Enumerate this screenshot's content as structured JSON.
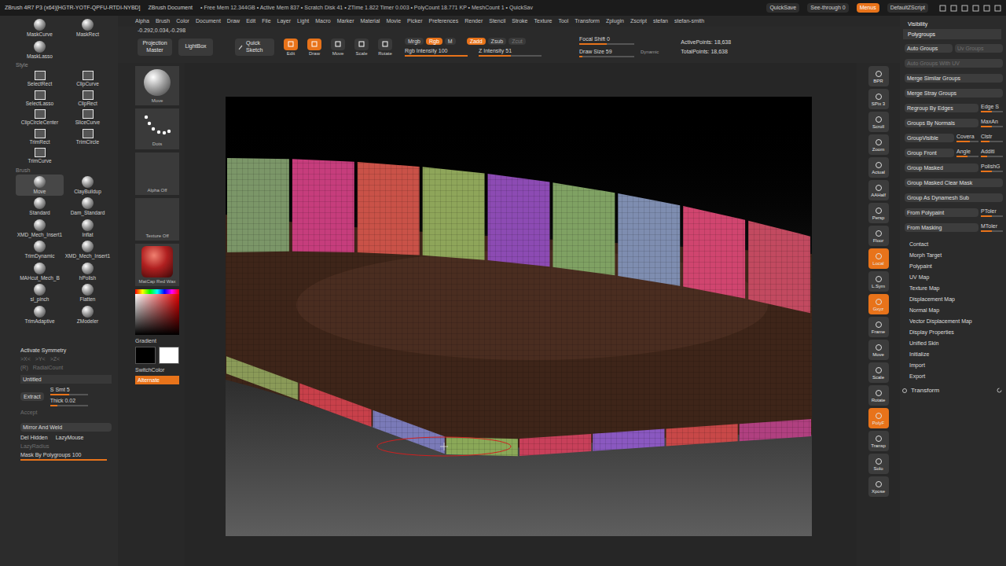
{
  "title_bar": {
    "app": "ZBrush 4R7 P3 (x64)[HGTR-YOTF-QPFU-RTDI-NYBD]",
    "document": "ZBrush Document",
    "stats": "• Free Mem 12.344GB • Active Mem 837 • Scratch Disk 41 • ZTime 1.822 Timer 0.003 • PolyCount 18.771 KP • MeshCount 1 • QuickSav",
    "buttons": [
      {
        "label": "QuickSave",
        "active": false
      },
      {
        "label": "See-through 0",
        "active": false
      },
      {
        "label": "Menus",
        "active": true
      },
      {
        "label": "DefaultZScript",
        "active": false
      }
    ]
  },
  "menu_bar": [
    "Alpha",
    "Brush",
    "Color",
    "Document",
    "Draw",
    "Edit",
    "File",
    "Layer",
    "Light",
    "Macro",
    "Marker",
    "Material",
    "Movie",
    "Picker",
    "Preferences",
    "Render",
    "Stencil",
    "Stroke",
    "Texture",
    "Tool",
    "Transform",
    "Zplugin",
    "Zscript",
    "stefan",
    "stefan-smith"
  ],
  "left_tray": {
    "tool_rows": [
      {
        "kind": "tools",
        "items": [
          {
            "label": "MaskCurve",
            "icon": "brush",
            "selected": false
          },
          {
            "label": "MaskRect",
            "icon": "brush",
            "selected": false
          }
        ]
      },
      {
        "kind": "tools",
        "items": [
          {
            "label": "MaskLasso",
            "icon": "brush",
            "selected": false
          }
        ]
      },
      {
        "kind": "header",
        "label": "Style"
      },
      {
        "kind": "tools",
        "items": [
          {
            "label": "SelectRect",
            "icon": "shape",
            "selected": false
          },
          {
            "label": "ClipCurve",
            "icon": "shape",
            "selected": false
          }
        ]
      },
      {
        "kind": "tools",
        "items": [
          {
            "label": "SelectLasso",
            "icon": "shape",
            "selected": false
          },
          {
            "label": "ClipRect",
            "icon": "shape",
            "selected": false
          }
        ]
      },
      {
        "kind": "tools",
        "items": [
          {
            "label": "ClipCircleCenter",
            "icon": "shape",
            "selected": false
          },
          {
            "label": "SliceCurve",
            "icon": "shape",
            "selected": false
          }
        ]
      },
      {
        "kind": "tools",
        "items": [
          {
            "label": "TrimRect",
            "icon": "shape",
            "selected": false
          },
          {
            "label": "TrimCircle",
            "icon": "shape",
            "selected": false
          }
        ]
      },
      {
        "kind": "tools",
        "items": [
          {
            "label": "TrimCurve",
            "icon": "shape",
            "selected": false
          }
        ]
      },
      {
        "kind": "header",
        "label": "Brush"
      },
      {
        "kind": "tools",
        "items": [
          {
            "label": "Move",
            "icon": "brush",
            "selected": true
          },
          {
            "label": "ClayBuildup",
            "icon": "brush",
            "selected": false
          }
        ]
      },
      {
        "kind": "tools",
        "items": [
          {
            "label": "Standard",
            "icon": "brush",
            "selected": false
          },
          {
            "label": "Dam_Standard",
            "icon": "brush",
            "selected": false
          }
        ]
      },
      {
        "kind": "tools",
        "items": [
          {
            "label": "XMD_Mech_Insert1",
            "icon": "brush",
            "selected": false
          },
          {
            "label": "Inflat",
            "icon": "brush",
            "selected": false
          }
        ]
      },
      {
        "kind": "tools",
        "items": [
          {
            "label": "TrimDynamic",
            "icon": "brush",
            "selected": false
          },
          {
            "label": "XMD_Mech_Insert1",
            "icon": "brush",
            "selected": false
          }
        ]
      },
      {
        "kind": "tools",
        "items": [
          {
            "label": "MAHcut_Mech_B",
            "icon": "brush",
            "selected": false
          },
          {
            "label": "hPolish",
            "icon": "brush",
            "selected": false
          }
        ]
      },
      {
        "kind": "tools",
        "items": [
          {
            "label": "sl_pinch",
            "icon": "brush",
            "selected": false
          },
          {
            "label": "Flatten",
            "icon": "brush",
            "selected": false
          }
        ]
      },
      {
        "kind": "tools",
        "items": [
          {
            "label": "TrimAdaptive",
            "icon": "brush",
            "selected": false
          },
          {
            "label": "ZModeler",
            "icon": "brush",
            "selected": false
          }
        ]
      }
    ],
    "subtool": {
      "symmetry": "Activate Symmetry",
      "axes": [
        {
          "label": ">X<",
          "disabled": true
        },
        {
          "label": ">Y<",
          "disabled": true
        },
        {
          "label": ">Z<",
          "disabled": true
        }
      ],
      "radial": [
        {
          "label": "(R)",
          "disabled": true
        },
        {
          "label": "RadialCount",
          "disabled": true
        }
      ],
      "name": "Untitled",
      "extract": "Extract",
      "smt": {
        "label": "S Smt 5",
        "level": 0.5
      },
      "thick": {
        "label": "Thick 0.02",
        "level": 0.2
      },
      "accept": {
        "label": "Accept",
        "disabled": true
      },
      "mirror_and_weld": "Mirror And Weld",
      "del_hidden": "Del Hidden",
      "lazy_mouse": "LazyMouse",
      "lazy_radius": {
        "label": "LazyRadius",
        "disabled": true
      },
      "mask_by_polygroups": {
        "label": "Mask By Polygroups 100",
        "level": 1
      }
    }
  },
  "top_shelf": {
    "coordinates": "-0.292,0.034,-0.298",
    "buttons": [
      {
        "label": "Projection Master"
      },
      {
        "label": "LightBox"
      }
    ],
    "quick_sketch": "Quick Sketch",
    "modes": [
      {
        "label": "Edit",
        "active": true
      },
      {
        "label": "Draw",
        "active": true
      },
      {
        "label": "Move",
        "active": false
      },
      {
        "label": "Scale",
        "active": false
      },
      {
        "label": "Rotate",
        "active": false
      }
    ],
    "channel_toggles": [
      {
        "label": "Mrgb",
        "active": false
      },
      {
        "label": "Rgb",
        "active": true
      },
      {
        "label": "M",
        "active": false
      }
    ],
    "z_toggles": [
      {
        "label": "Zadd",
        "active": true,
        "disabled": false
      },
      {
        "label": "Zsub",
        "active": false,
        "disabled": false
      },
      {
        "label": "Zcut",
        "active": false,
        "disabled": true
      }
    ],
    "intensity_sliders": [
      {
        "label": "Rgb Intensity 100",
        "level": 1
      },
      {
        "label": "Z Intensity 51",
        "level": 0.51
      }
    ],
    "draw_sliders": [
      {
        "label": "Focal Shift 0",
        "level": 0.5
      },
      {
        "label": "Draw Size 59",
        "level": 0.06
      }
    ],
    "dynamic": "Dynamic",
    "stats": [
      "ActivePoints: 18,638",
      "TotalPoints: 18,638"
    ]
  },
  "left_shelf": {
    "brush": "Move",
    "stroke": "Dots",
    "alpha": "Alpha Off",
    "texture": "Texture Off",
    "material": "MatCap Red Wax",
    "gradient": "Gradient",
    "swatches": [
      {
        "color": "#000000"
      },
      {
        "color": "#ffffff"
      }
    ],
    "switch_color": "SwitchColor",
    "alternate": {
      "label": "Alternate",
      "active": true
    }
  },
  "viewport": {
    "model": {
      "top_groups": [
        {
          "color": "#7b9668"
        },
        {
          "color": "#c63d7c"
        },
        {
          "color": "#c95248"
        },
        {
          "color": "#8ea55a"
        },
        {
          "color": "#8c4bb3"
        },
        {
          "color": "#7fa163"
        },
        {
          "color": "#7e8db0"
        },
        {
          "color": "#d0456f"
        },
        {
          "color": "#c24a60"
        }
      ],
      "bottom_groups": [
        {
          "color": "#8a9a58"
        },
        {
          "color": "#c8404a"
        },
        {
          "color": "#7a7ab8"
        },
        {
          "color": "#8aa858"
        },
        {
          "color": "#c8405a"
        },
        {
          "color": "#8a58c0"
        },
        {
          "color": "#c84848"
        },
        {
          "color": "#b04080"
        }
      ]
    }
  },
  "right_shelf": [
    {
      "label": "BPR",
      "active": false
    },
    {
      "label": "SPix 3",
      "active": false
    },
    {
      "label": "Scroll",
      "active": false
    },
    {
      "label": "Zoom",
      "active": false
    },
    {
      "label": "Actual",
      "active": false
    },
    {
      "label": "AAHalf",
      "active": false
    },
    {
      "label": "Persp",
      "active": false
    },
    {
      "label": "Floor",
      "active": false
    },
    {
      "label": "Local",
      "active": true
    },
    {
      "label": "L.Sym",
      "active": false
    },
    {
      "label": "Gxyz",
      "active": true
    },
    {
      "label": "Frame",
      "active": false
    },
    {
      "label": "Move",
      "active": false
    },
    {
      "label": "Scale",
      "active": false
    },
    {
      "label": "Rotate",
      "active": false
    },
    {
      "label": "PolyF",
      "active": true
    },
    {
      "label": "Transp",
      "active": false
    },
    {
      "label": "Solo",
      "active": false
    },
    {
      "label": "Xpose",
      "active": false
    }
  ],
  "right_panel": {
    "visibility": "Visibility",
    "polygroups": {
      "title": "Polygroups",
      "rows": [
        [
          {
            "kind": "button",
            "label": "Auto Groups",
            "disabled": false
          },
          {
            "kind": "button",
            "label": "Uv Groups",
            "disabled": true
          }
        ],
        [
          {
            "kind": "button",
            "label": "Auto Groups With UV",
            "disabled": true
          }
        ],
        [
          {
            "kind": "button",
            "label": "Merge Similar Groups",
            "disabled": false
          }
        ],
        [
          {
            "kind": "button",
            "label": "Merge Stray Groups",
            "disabled": false
          }
        ],
        [
          {
            "kind": "button",
            "label": "Regroup By Edges",
            "disabled": false
          },
          {
            "kind": "slider",
            "label": "Edge S",
            "level": 0.5
          }
        ],
        [
          {
            "kind": "button",
            "label": "Groups By Normals",
            "disabled": false
          },
          {
            "kind": "slider",
            "label": "MaxAn",
            "level": 0.5
          }
        ],
        [
          {
            "kind": "button",
            "label": "GroupVisible",
            "disabled": false
          },
          {
            "kind": "slider",
            "label": "Covera",
            "level": 0.6
          },
          {
            "kind": "slider",
            "label": "Clstr",
            "level": 0.4
          }
        ],
        [
          {
            "kind": "button",
            "label": "Group Front",
            "disabled": false
          },
          {
            "kind": "slider",
            "label": "Angle",
            "level": 0.5
          },
          {
            "kind": "slider",
            "label": "Additi",
            "level": 0.3
          }
        ],
        [
          {
            "kind": "button",
            "label": "Group Masked",
            "disabled": false
          },
          {
            "kind": "slider",
            "label": "PolishG",
            "level": 0.5
          }
        ],
        [
          {
            "kind": "button",
            "label": "Group Masked Clear Mask",
            "disabled": false
          }
        ],
        [
          {
            "kind": "button",
            "label": "Group As Dynamesh Sub",
            "disabled": false
          }
        ],
        [
          {
            "kind": "button",
            "label": "From Polypaint",
            "disabled": false
          },
          {
            "kind": "slider",
            "label": "PToler",
            "level": 0.5
          }
        ],
        [
          {
            "kind": "button",
            "label": "From Masking",
            "disabled": false
          },
          {
            "kind": "slider",
            "label": "MToler",
            "level": 0.5
          }
        ]
      ]
    },
    "subpalettes": [
      "Contact",
      "Morph Target",
      "Polypaint",
      "UV Map",
      "Texture Map",
      "Displacement Map",
      "Normal Map",
      "Vector Displacement Map",
      "Display Properties",
      "Unified Skin",
      "Initialize",
      "Import",
      "Export"
    ],
    "transform": "Transform"
  }
}
